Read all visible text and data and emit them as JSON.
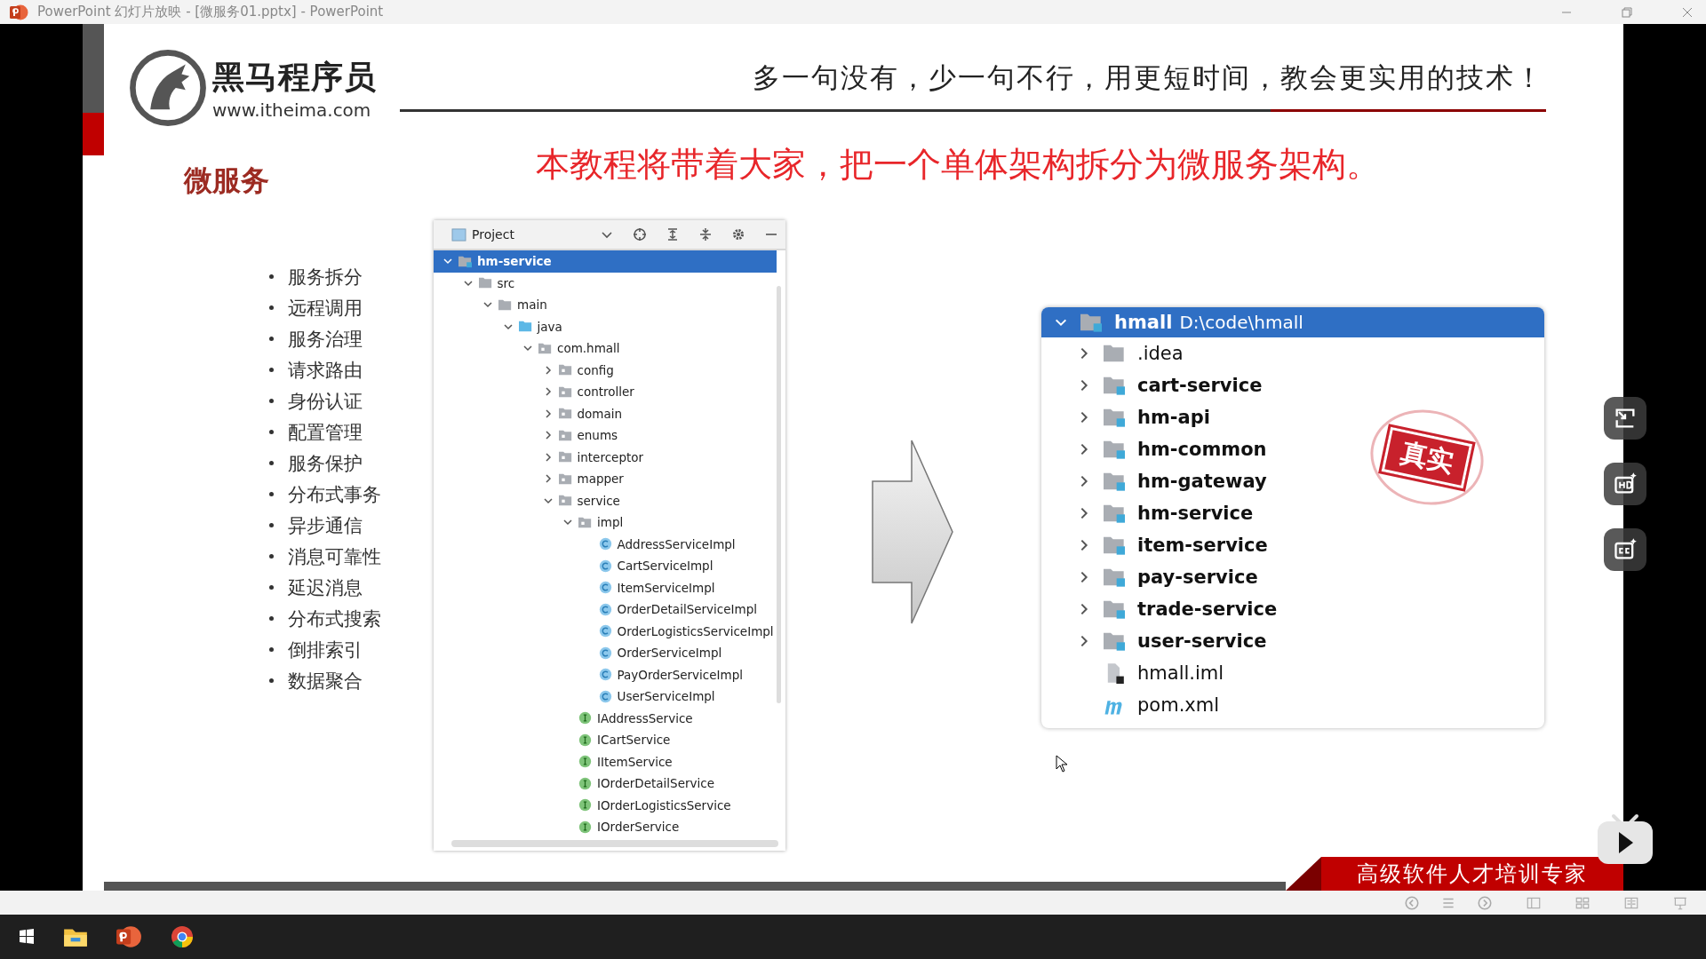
{
  "window": {
    "title": "PowerPoint 幻灯片放映 - [微服务01.pptx] - PowerPoint"
  },
  "slide": {
    "logo": {
      "name": "黑马程序员",
      "url": "www.itheima.com"
    },
    "tagline": "多一句没有，少一句不行，用更短时间，教会更实用的技术！",
    "title": "微服务",
    "headline": "本教程将带着大家，把一个单体架构拆分为微服务架构。",
    "bullets": [
      "服务拆分",
      "远程调用",
      "服务治理",
      "请求路由",
      "身份认证",
      "配置管理",
      "服务保护",
      "分布式事务",
      "异步通信",
      "消息可靠性",
      "延迟消息",
      "分布式搜索",
      "倒排索引",
      "数据聚合"
    ],
    "project_panel": {
      "title": "Project",
      "tree": [
        {
          "label": "hm-service",
          "kind": "module",
          "expanded": true,
          "selected": true,
          "children": [
            {
              "label": "src",
              "kind": "folder",
              "expanded": true,
              "selected": false,
              "children": [
                {
                  "label": "main",
                  "kind": "folder",
                  "expanded": true,
                  "selected": false,
                  "children": [
                    {
                      "label": "java",
                      "kind": "source-folder",
                      "expanded": true,
                      "selected": false,
                      "children": [
                        {
                          "label": "com.hmall",
                          "kind": "package",
                          "expanded": true,
                          "selected": false,
                          "children": [
                            {
                              "label": "config",
                              "kind": "package",
                              "expanded": false,
                              "selected": false
                            },
                            {
                              "label": "controller",
                              "kind": "package",
                              "expanded": false,
                              "selected": false
                            },
                            {
                              "label": "domain",
                              "kind": "package",
                              "expanded": false,
                              "selected": false
                            },
                            {
                              "label": "enums",
                              "kind": "package",
                              "expanded": false,
                              "selected": false
                            },
                            {
                              "label": "interceptor",
                              "kind": "package",
                              "expanded": false,
                              "selected": false
                            },
                            {
                              "label": "mapper",
                              "kind": "package",
                              "expanded": false,
                              "selected": false
                            },
                            {
                              "label": "service",
                              "kind": "package",
                              "expanded": true,
                              "selected": false,
                              "children": [
                                {
                                  "label": "impl",
                                  "kind": "package",
                                  "expanded": true,
                                  "selected": false,
                                  "children": [
                                    {
                                      "label": "AddressServiceImpl",
                                      "kind": "class",
                                      "selected": false
                                    },
                                    {
                                      "label": "CartServiceImpl",
                                      "kind": "class",
                                      "selected": false
                                    },
                                    {
                                      "label": "ItemServiceImpl",
                                      "kind": "class",
                                      "selected": false
                                    },
                                    {
                                      "label": "OrderDetailServiceImpl",
                                      "kind": "class",
                                      "selected": false
                                    },
                                    {
                                      "label": "OrderLogisticsServiceImpl",
                                      "kind": "class",
                                      "selected": false
                                    },
                                    {
                                      "label": "OrderServiceImpl",
                                      "kind": "class",
                                      "selected": false
                                    },
                                    {
                                      "label": "PayOrderServiceImpl",
                                      "kind": "class",
                                      "selected": false
                                    },
                                    {
                                      "label": "UserServiceImpl",
                                      "kind": "class",
                                      "selected": false
                                    }
                                  ]
                                },
                                {
                                  "label": "IAddressService",
                                  "kind": "interface",
                                  "selected": false
                                },
                                {
                                  "label": "ICartService",
                                  "kind": "interface",
                                  "selected": false
                                },
                                {
                                  "label": "IItemService",
                                  "kind": "interface",
                                  "selected": false
                                },
                                {
                                  "label": "IOrderDetailService",
                                  "kind": "interface",
                                  "selected": false
                                },
                                {
                                  "label": "IOrderLogisticsService",
                                  "kind": "interface",
                                  "selected": false
                                },
                                {
                                  "label": "IOrderService",
                                  "kind": "interface",
                                  "selected": false
                                }
                              ]
                            }
                          ]
                        }
                      ]
                    }
                  ]
                }
              ]
            }
          ]
        }
      ]
    },
    "module_panel": {
      "tree": [
        {
          "label": "hmall",
          "path": "D:\\code\\hmall",
          "kind": "module",
          "expanded": true,
          "selected": true,
          "children": [
            {
              "label": ".idea",
              "kind": "folder",
              "expanded": false,
              "selected": false
            },
            {
              "label": "cart-service",
              "kind": "module",
              "expanded": false,
              "selected": false
            },
            {
              "label": "hm-api",
              "kind": "module",
              "expanded": false,
              "selected": false
            },
            {
              "label": "hm-common",
              "kind": "module",
              "expanded": false,
              "selected": false
            },
            {
              "label": "hm-gateway",
              "kind": "module",
              "expanded": false,
              "selected": false
            },
            {
              "label": "hm-service",
              "kind": "module",
              "expanded": false,
              "selected": false
            },
            {
              "label": "item-service",
              "kind": "module",
              "expanded": false,
              "selected": false
            },
            {
              "label": "pay-service",
              "kind": "module",
              "expanded": false,
              "selected": false
            },
            {
              "label": "trade-service",
              "kind": "module",
              "expanded": false,
              "selected": false
            },
            {
              "label": "user-service",
              "kind": "module",
              "expanded": false,
              "selected": false
            },
            {
              "label": "hmall.iml",
              "kind": "iml-file",
              "selected": false
            },
            {
              "label": "pom.xml",
              "kind": "maven-file",
              "selected": false
            }
          ]
        }
      ]
    },
    "stamp": "真实",
    "banner": "高级软件人才培训专家"
  }
}
